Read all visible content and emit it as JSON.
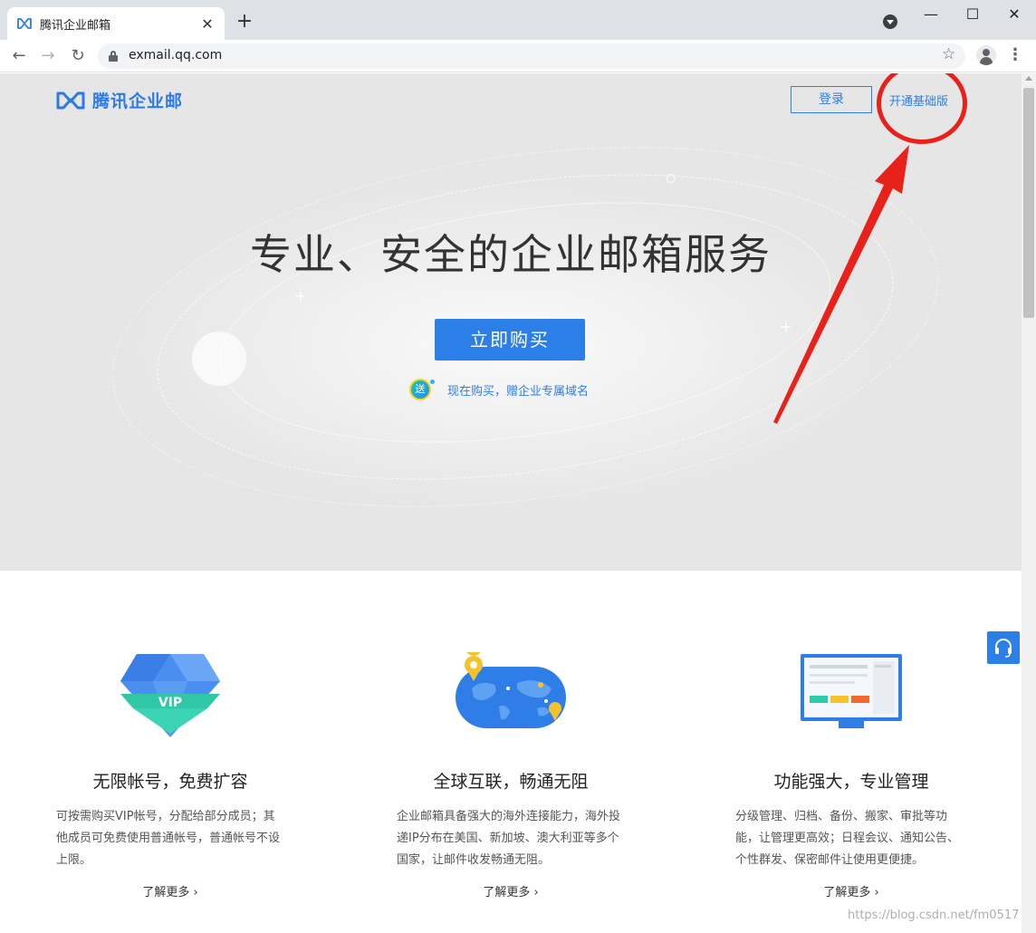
{
  "browser": {
    "tab_title": "腾讯企业邮箱",
    "tab_close": "✕",
    "new_tab": "+",
    "url": "exmail.qq.com",
    "window_controls": {
      "minimize": "—",
      "maximize": "☐",
      "close": "✕"
    },
    "icons": [
      "back-icon",
      "forward-icon",
      "reload-icon",
      "lock-icon",
      "star-icon",
      "profile-icon",
      "menu-icon",
      "tab-search-icon"
    ]
  },
  "header": {
    "logo_text": "腾讯企业邮",
    "login_label": "登录",
    "basic_label": "开通基础版"
  },
  "hero": {
    "title": "专业、安全的企业邮箱服务",
    "buy_label": "立即购买",
    "gift_badge": "送",
    "promo_text": "现在购买，赠企业专属域名"
  },
  "features": [
    {
      "title": "无限帐号，免费扩容",
      "desc": "可按需购买VIP帐号，分配给部分成员；其他成员可免费使用普通帐号，普通帐号不设上限。",
      "more": "了解更多",
      "icon_badge": "VIP"
    },
    {
      "title": "全球互联，畅通无阻",
      "desc": "企业邮箱具备强大的海外连接能力，海外投递IP分布在美国、新加坡、澳大利亚等多个国家，让邮件收发畅通无阻。",
      "more": "了解更多"
    },
    {
      "title": "功能强大，专业管理",
      "desc": "分级管理、归档、备份、搬家、审批等功能，让管理更高效；日程会议、通知公告、个性群发、保密邮件让使用更便捷。",
      "more": "了解更多"
    }
  ],
  "watermark": "https://blog.csdn.net/fm0517",
  "colors": {
    "brand_blue": "#2d7fe8",
    "annotation_red": "#e8211a"
  }
}
